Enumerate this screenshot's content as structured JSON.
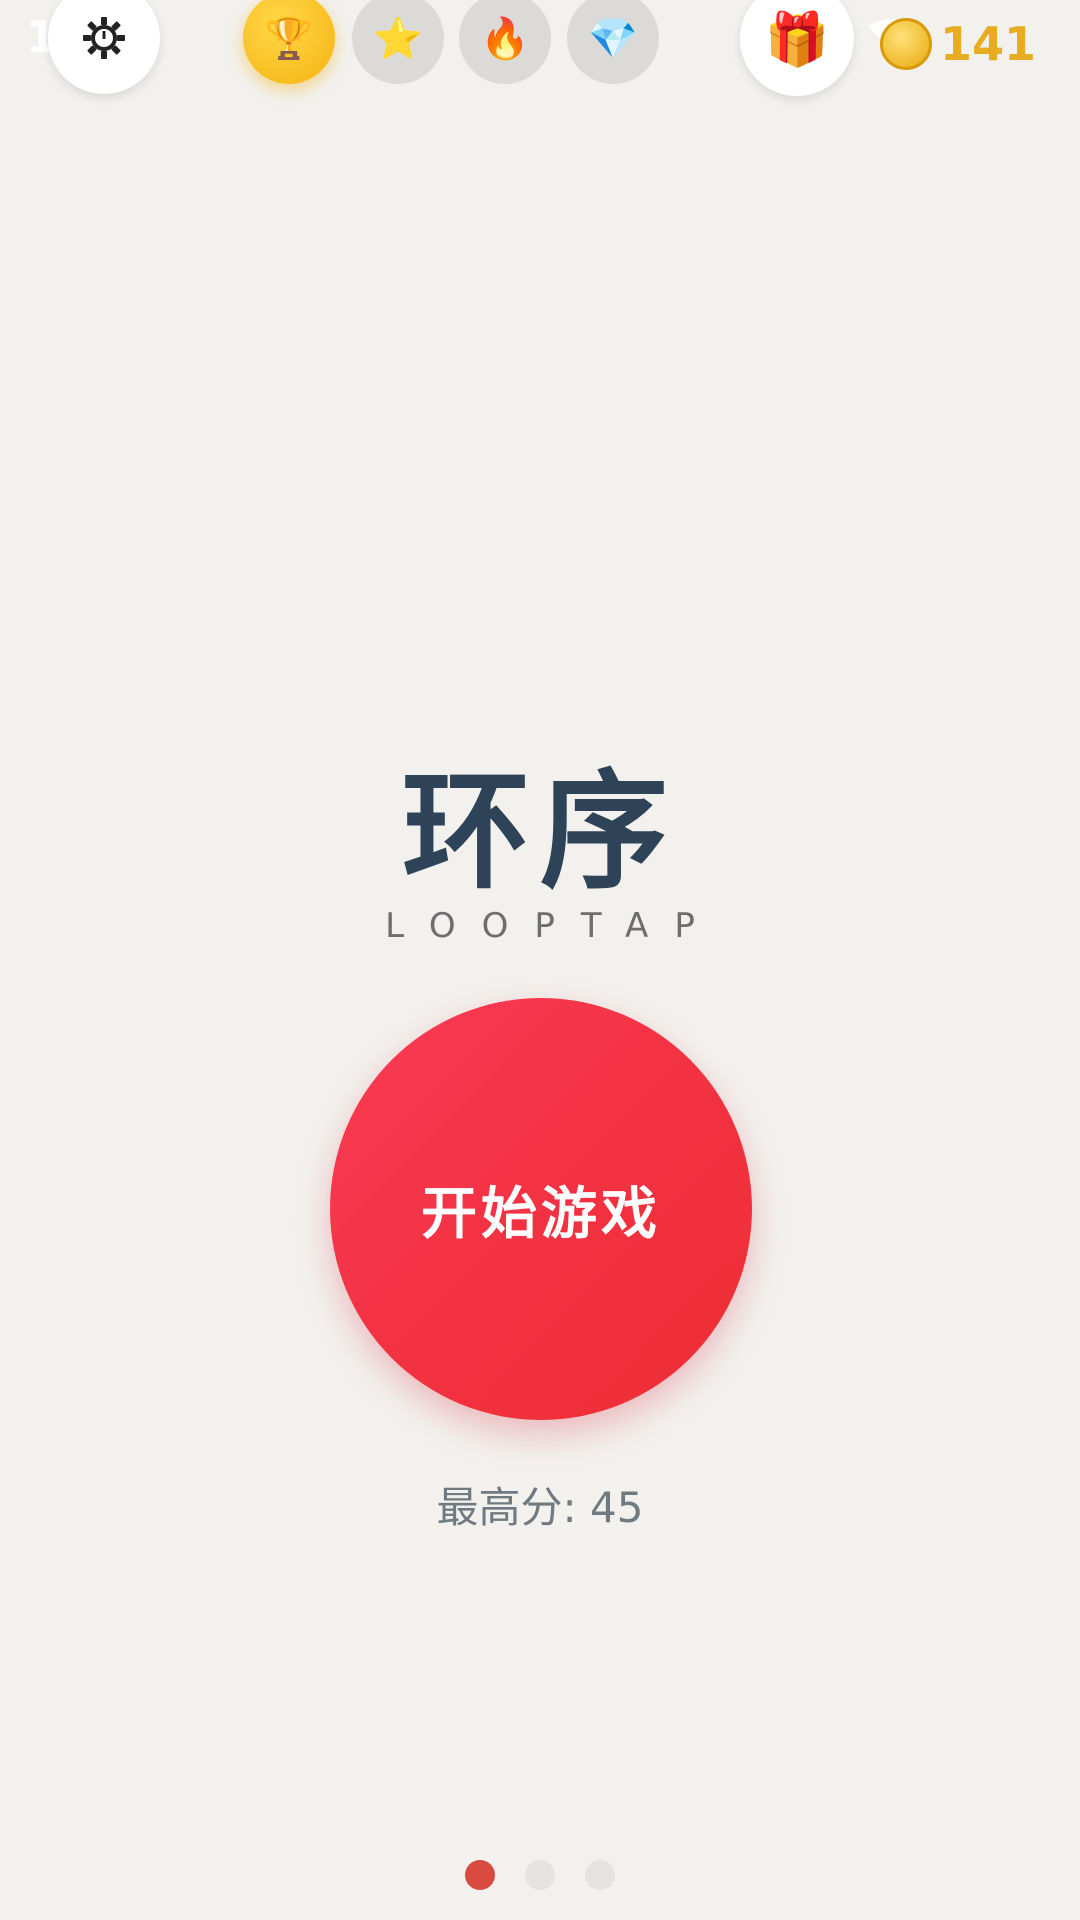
{
  "status_bar": {
    "time": "1"
  },
  "header": {
    "settings_icon": "gear-icon",
    "badges": [
      {
        "icon": "trophy-icon",
        "glyph": "🏆",
        "active": true
      },
      {
        "icon": "star-icon",
        "glyph": "⭐",
        "active": false
      },
      {
        "icon": "fire-icon",
        "glyph": "🔥",
        "active": false
      },
      {
        "icon": "diamond-icon",
        "glyph": "💎",
        "active": false
      }
    ],
    "gift_icon": "gift-icon",
    "gift_glyph": "🎁",
    "coin_icon": "coin-icon",
    "coins": "141"
  },
  "title": {
    "main": "环序",
    "sub": "LOOPTAP"
  },
  "start_button": {
    "label": "开始游戏"
  },
  "high_score": {
    "text": "最高分: 45"
  },
  "pager": {
    "page_count": 3,
    "current": 1
  },
  "colors": {
    "background": "#f2f1ee",
    "title": "#2f4358",
    "start_button": "#f1313f",
    "coin_text": "#e8ac22",
    "pager_active": "#d94a40",
    "badge_active": "#f5b20e"
  }
}
